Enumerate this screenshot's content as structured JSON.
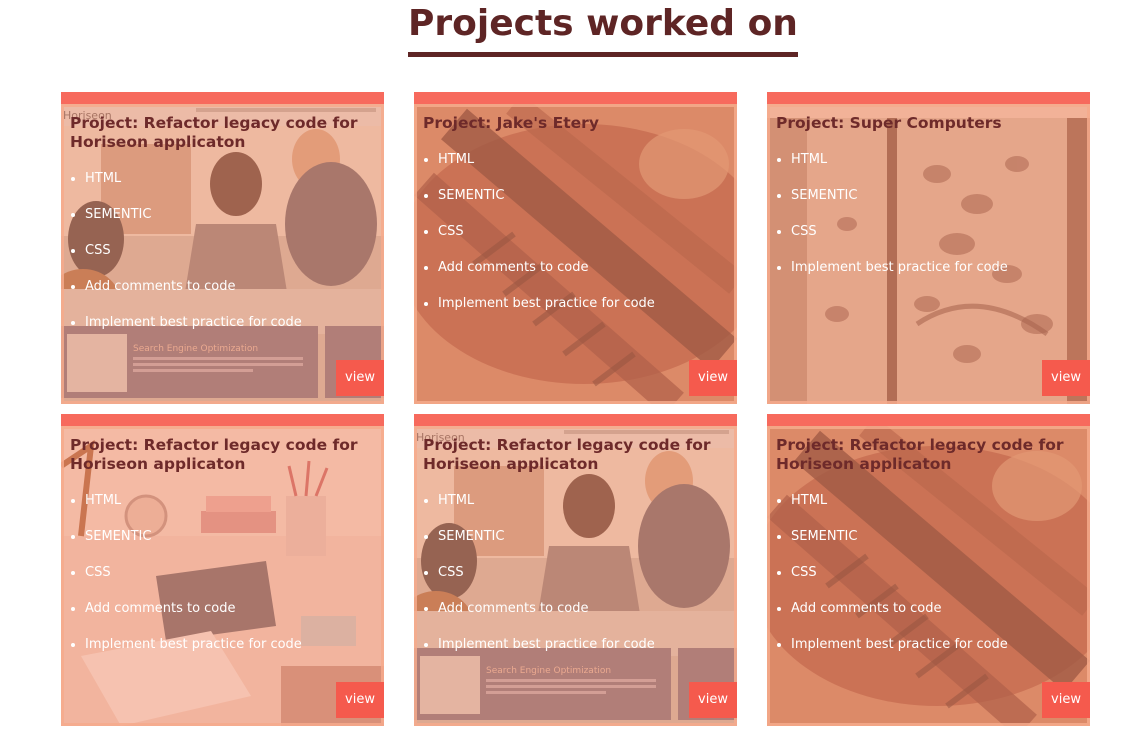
{
  "header": {
    "title": "Projects worked on"
  },
  "projects": [
    {
      "title": "Project: Refactor legacy code for Horiseon applicaton",
      "image": "team-meeting-photo",
      "skills": [
        "HTML",
        "SEMENTIC",
        "CSS",
        "Add comments to code",
        "Implement best practice for code"
      ],
      "button": "view"
    },
    {
      "title": "Project: Jake's Etery",
      "image": "grilled-steak-photo",
      "skills": [
        "HTML",
        "SEMENTIC",
        "CSS",
        "Add comments to code",
        "Implement best practice for code"
      ],
      "button": "view"
    },
    {
      "title": "Project: Super Computers",
      "image": "leopard-mural-photo",
      "skills": [
        "HTML",
        "SEMENTIC",
        "CSS",
        "Implement best practice for code"
      ],
      "button": "view"
    },
    {
      "title": "Project: Refactor legacy code for Horiseon applicaton",
      "image": "office-desk-photo",
      "skills": [
        "HTML",
        "SEMENTIC",
        "CSS",
        "Add comments to code",
        "Implement best practice for code"
      ],
      "button": "view"
    },
    {
      "title": "Project: Refactor legacy code for Horiseon applicaton",
      "image": "team-meeting-photo",
      "skills": [
        "HTML",
        "SEMENTIC",
        "CSS",
        "Add comments to code",
        "Implement best practice for code"
      ],
      "button": "view"
    },
    {
      "title": "Project: Refactor legacy code for Horiseon applicaton",
      "image": "grilled-steak-photo",
      "skills": [
        "HTML",
        "SEMENTIC",
        "CSS",
        "Add comments to code",
        "Implement best practice for code"
      ],
      "button": "view"
    }
  ],
  "screenshot_text": {
    "horiseon_logo": "Horiseon",
    "seo_heading": "Search Engine Optimization"
  },
  "colors": {
    "title": "#5e2525",
    "card_top_bar": "#f76a5d",
    "view_button": "#f55a4d",
    "card_title_text": "#6e2a2a",
    "list_text": "#ffffff"
  }
}
